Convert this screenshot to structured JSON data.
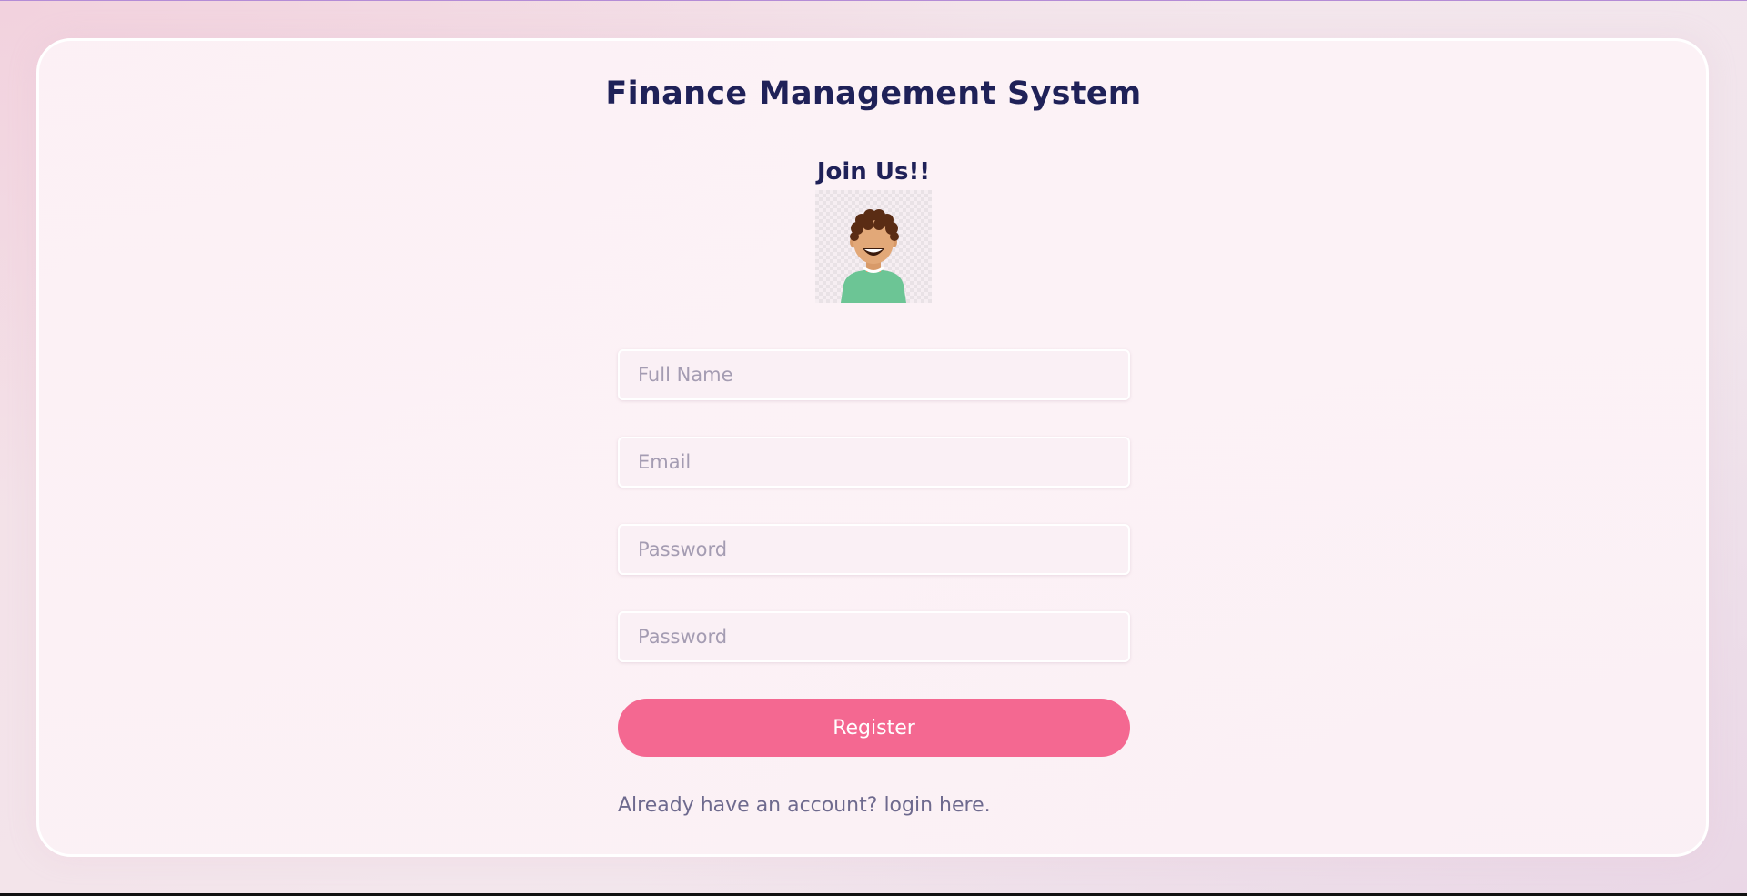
{
  "app": {
    "title": "Finance Management System"
  },
  "form": {
    "heading": "Join Us!!",
    "avatar_icon": "user-avatar-icon",
    "fields": [
      {
        "name": "full-name",
        "placeholder": "Full Name",
        "value": ""
      },
      {
        "name": "email",
        "placeholder": "Email",
        "value": ""
      },
      {
        "name": "password",
        "placeholder": "Password",
        "value": ""
      },
      {
        "name": "confirm-password",
        "placeholder": "Password",
        "value": ""
      }
    ],
    "submit_label": "Register",
    "login_prompt": "Already have an account?",
    "login_link": "login here."
  },
  "colors": {
    "accent": "#f46891",
    "heading": "#1f2158",
    "muted_text": "#6e6a8e",
    "placeholder": "#a49cb2"
  }
}
